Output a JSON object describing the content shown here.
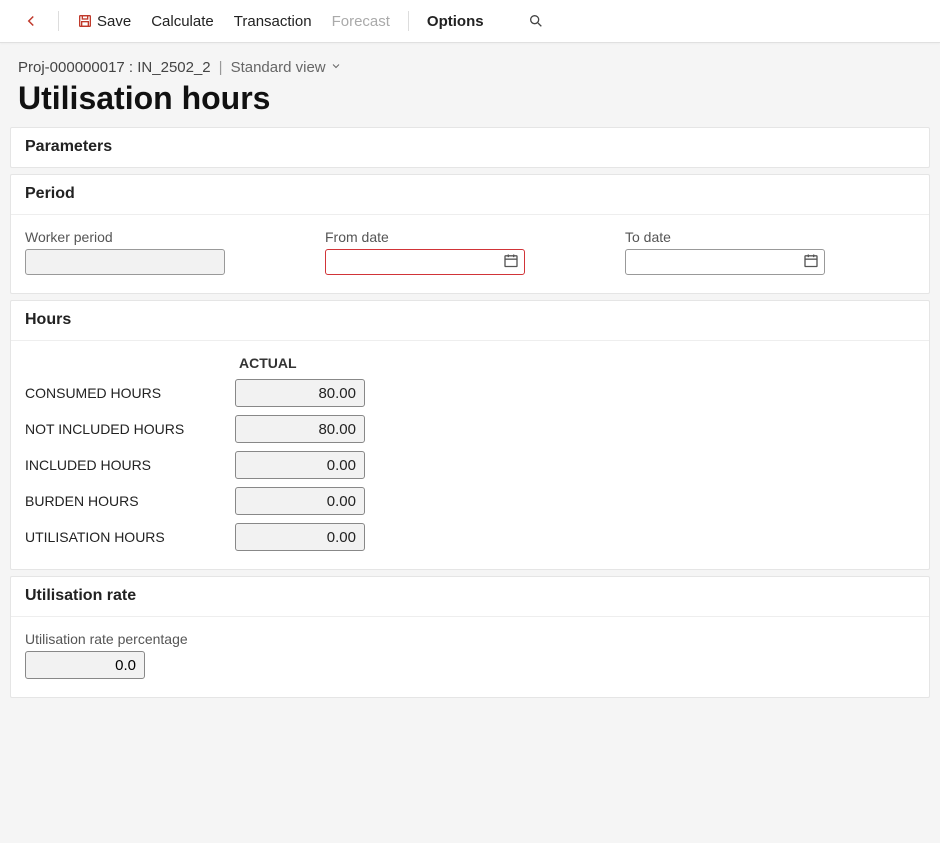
{
  "toolbar": {
    "save_label": "Save",
    "calculate_label": "Calculate",
    "transaction_label": "Transaction",
    "forecast_label": "Forecast",
    "options_label": "Options"
  },
  "breadcrumb": {
    "project": "Proj-000000017 : IN_2502_2",
    "view": "Standard view"
  },
  "page_title": "Utilisation hours",
  "sections": {
    "parameters": {
      "title": "Parameters"
    },
    "period": {
      "title": "Period",
      "worker_period_label": "Worker period",
      "worker_period_value": "",
      "from_date_label": "From date",
      "from_date_value": "",
      "to_date_label": "To date",
      "to_date_value": ""
    },
    "hours": {
      "title": "Hours",
      "column_header": "ACTUAL",
      "rows": [
        {
          "label": "CONSUMED HOURS",
          "value": "80.00"
        },
        {
          "label": "NOT INCLUDED HOURS",
          "value": "80.00"
        },
        {
          "label": "INCLUDED HOURS",
          "value": "0.00"
        },
        {
          "label": "BURDEN HOURS",
          "value": "0.00"
        },
        {
          "label": "UTILISATION HOURS",
          "value": "0.00"
        }
      ]
    },
    "rate": {
      "title": "Utilisation rate",
      "percentage_label": "Utilisation rate percentage",
      "percentage_value": "0.0"
    }
  }
}
